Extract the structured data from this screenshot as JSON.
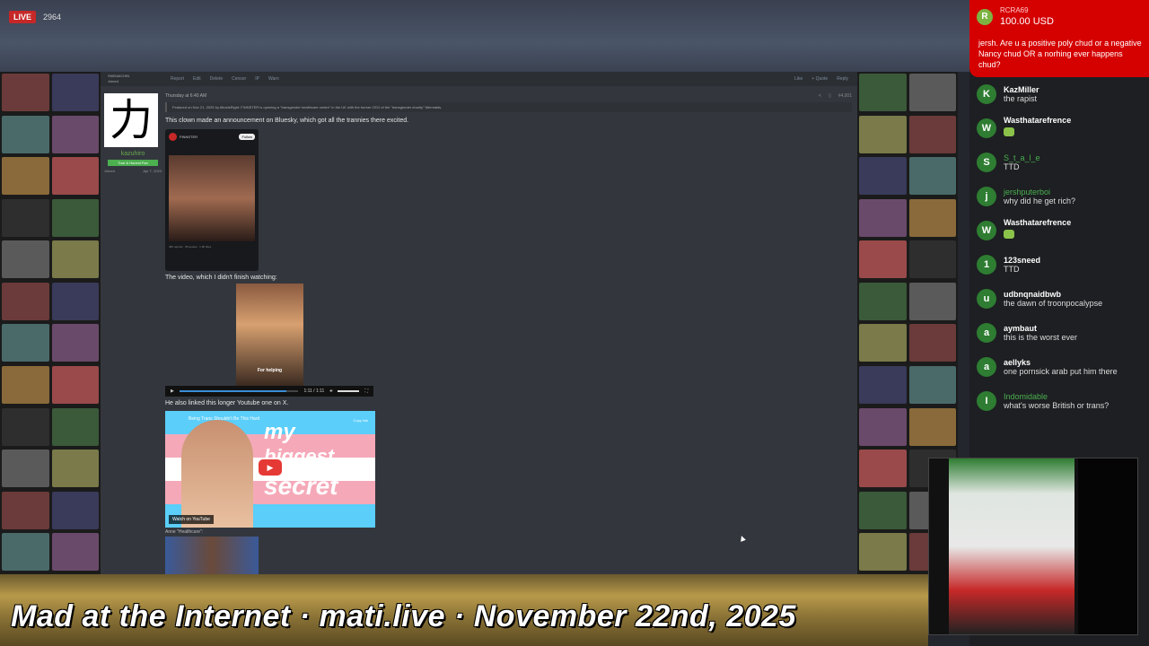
{
  "stream": {
    "live_label": "LIVE",
    "viewers": "2964",
    "banner": "Mad at the Internet · mati.live · November 22nd, 2025"
  },
  "forum": {
    "toolbar": {
      "left_items": [
        "Report",
        "Edit",
        "Delete",
        "Censor",
        "IP",
        "Warn"
      ],
      "right_items": [
        "Like",
        "+ Quote",
        "Reply"
      ]
    },
    "previous_user": {
      "name": "SNEMACHIN",
      "joined_label": "Joined"
    },
    "user": {
      "avatar_char": "力",
      "name": "kazuhiro",
      "title": "True & Honest Fan",
      "joined_label": "Joined",
      "joined_date": "Apr 7, 2023"
    },
    "post": {
      "timestamp": "Thursday at 6:40 AM",
      "post_number": "#4,001",
      "featured": "Featured on Nov 21, 2025 by AltoidsRight: FINNSTER is opening a \"transgender healthcare centre\" in the UK with the former CEO of the \"transgender charity\" Mermaids.",
      "line1": "This clown made an announcement on Bluesky, which got all the trannies there excited.",
      "embed": {
        "name": "FINNSTER",
        "follow": "Follow",
        "stats": "482 reposts · 86 quotes · 1.9K likes"
      },
      "line2": "The video, which I didn't finish watching:",
      "video_caption": "For helping",
      "player_time": "1:11 / 1:11",
      "player_progress": 0.9,
      "line3": "He also linked this longer Youtube one on X.",
      "youtube": {
        "title": "Being Trans Shouldn't Be This Hard",
        "watch_label": "Watch on  YouTube",
        "later": "Copy link",
        "big1": "my",
        "big2": "biggest",
        "big3": "secret"
      },
      "anne_label": "Anne \"Healthcare\":"
    }
  },
  "chat": {
    "superchat": {
      "initial": "R",
      "name": "RCRA69",
      "amount": "100.00 USD",
      "message": "jersh. Are u a positive poly chud or a negative Nancy chud OR a norhing ever happens chud?"
    },
    "messages": [
      {
        "initial": "K",
        "name": "KazMiller",
        "text": "the rapist",
        "green": false
      },
      {
        "initial": "W",
        "name": "Wasthatarefrence",
        "text": "",
        "emote": true,
        "green": false
      },
      {
        "initial": "S",
        "name": "S_t_a_l_e",
        "text": "TTD",
        "green": true
      },
      {
        "initial": "j",
        "name": "jershputerboi",
        "text": "why did he get rich?",
        "green": true
      },
      {
        "initial": "W",
        "name": "Wasthatarefrence",
        "text": "",
        "emote": true,
        "green": false
      },
      {
        "initial": "1",
        "name": "123sneed",
        "text": "TTD",
        "green": false
      },
      {
        "initial": "u",
        "name": "udbnqnaidbwb",
        "text": "the dawn of troonpocalypse",
        "green": false
      },
      {
        "initial": "a",
        "name": "aymbaut",
        "text": "this is the worst ever",
        "green": false
      },
      {
        "initial": "a",
        "name": "aellyks",
        "text": "one pornsick arab put him there",
        "green": false
      },
      {
        "initial": "I",
        "name": "Indomidable",
        "text": "what's worse British or trans?",
        "green": true
      }
    ]
  },
  "colors": {
    "accent_red": "#d50000",
    "chat_bg": "#1d1f22",
    "forum_bg": "#33373d",
    "username_green": "#6aa84f"
  }
}
